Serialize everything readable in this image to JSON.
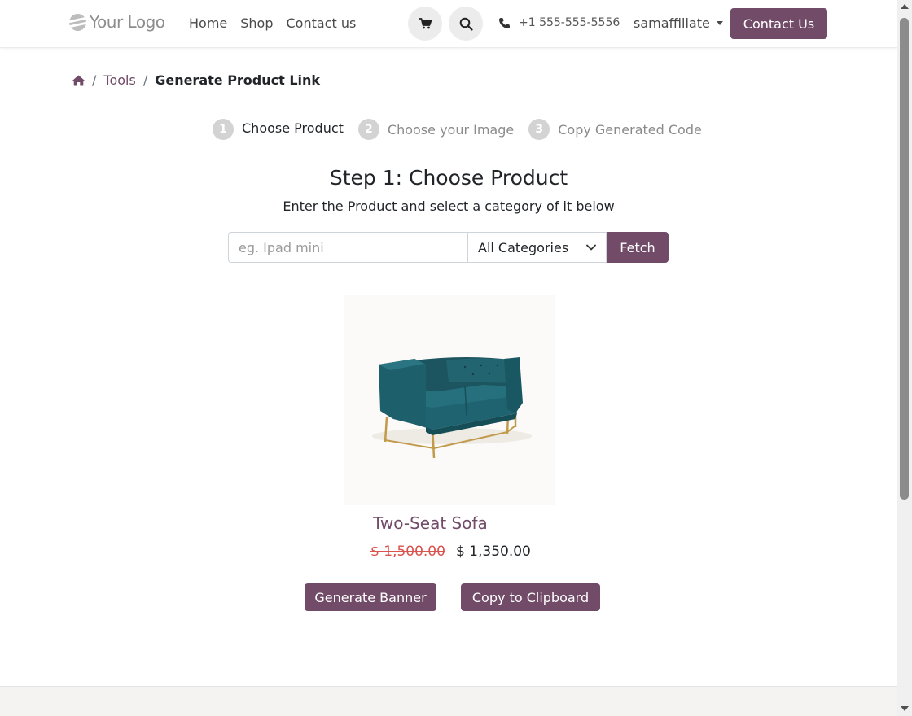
{
  "header": {
    "logo_text": "Your Logo",
    "nav": [
      "Home",
      "Shop",
      "Contact us"
    ],
    "phone": "+1 555-555-5556",
    "user": "samaffiliate",
    "contact_button": "Contact Us",
    "icons": {
      "cart": "cart-icon",
      "search": "search-icon",
      "phone": "phone-icon"
    }
  },
  "breadcrumb": {
    "home_icon": "home-icon",
    "tools": "Tools",
    "current": "Generate Product Link",
    "separator": "/"
  },
  "steps": [
    {
      "num": "1",
      "label": "Choose Product",
      "active": true
    },
    {
      "num": "2",
      "label": "Choose your Image",
      "active": false
    },
    {
      "num": "3",
      "label": "Copy Generated Code",
      "active": false
    }
  ],
  "main": {
    "title": "Step 1: Choose Product",
    "subtitle": "Enter the Product and select a category of it below",
    "search_placeholder": "eg. Ipad mini",
    "search_value": "",
    "category_selected": "All Categories",
    "fetch_button": "Fetch"
  },
  "product": {
    "name": "Two-Seat Sofa",
    "old_price": "$ 1,500.00",
    "new_price": "$ 1,350.00",
    "image": "sofa-image"
  },
  "actions": {
    "generate": "Generate Banner",
    "copy": "Copy to Clipboard"
  },
  "colors": {
    "brand": "#714b67",
    "strike_price": "#d9534f",
    "sofa": "#1f5f6a",
    "legs": "#c19a4b"
  }
}
